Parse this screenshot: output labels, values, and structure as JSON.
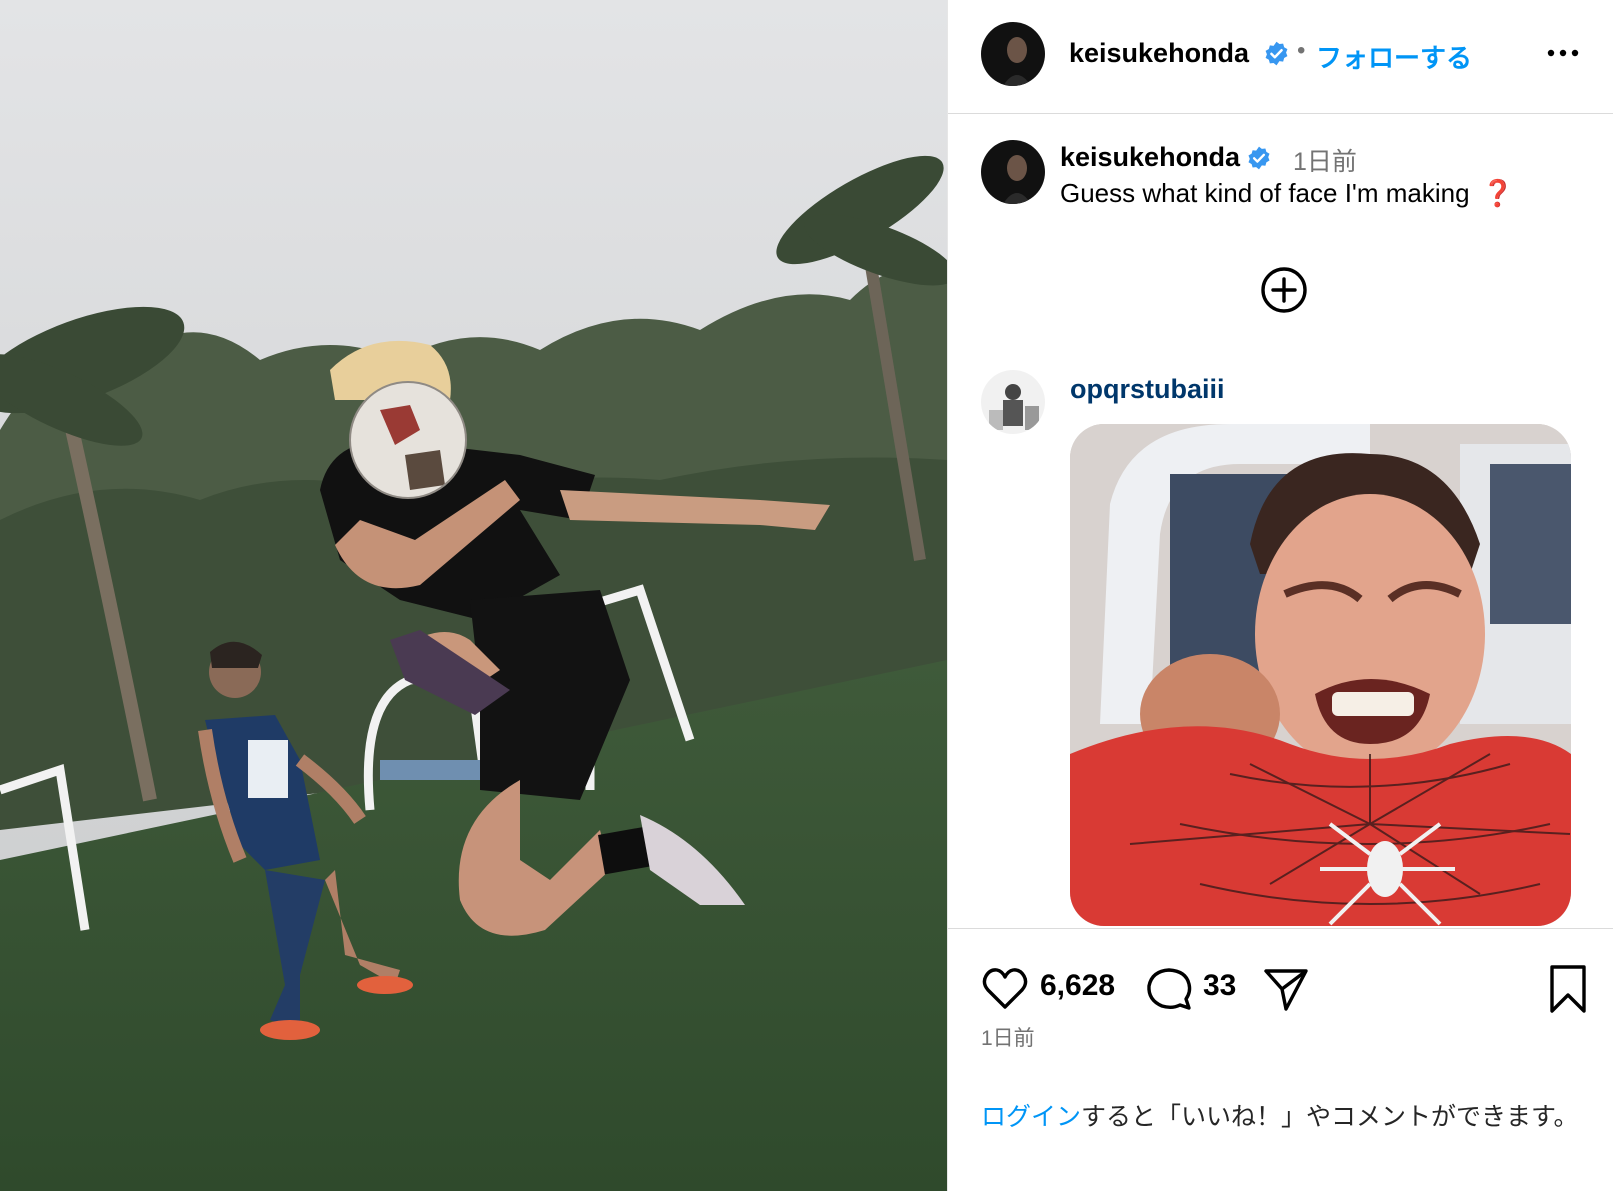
{
  "colors": {
    "accent": "#0095f6",
    "verified": "#3897f0",
    "muted": "#737373",
    "question_mark": "#e0312c",
    "commenter_name": "#00376b"
  },
  "photo": {
    "icon": "photo-soccer-player-headering-ball"
  },
  "header": {
    "username": "keisukehonda",
    "verified_icon": "verified-badge-icon",
    "separator": "•",
    "follow_label": "フォローする",
    "more_icon": "more-options-icon"
  },
  "caption": {
    "username": "keisukehonda",
    "time": "1日前",
    "text": "Guess what kind of face I'm making",
    "emoji": "❓"
  },
  "more_comments": {
    "icon": "plus-circle-icon"
  },
  "comment": {
    "username": "opqrstubaiii",
    "gif_icon": "spider-man-grimace-gif"
  },
  "actions": {
    "like_icon": "heart-icon",
    "like_count": "6,628",
    "comment_icon": "comment-icon",
    "comment_count": "33",
    "share_icon": "share-icon",
    "save_icon": "bookmark-icon",
    "post_time": "1日前"
  },
  "login_note": {
    "link": "ログイン",
    "text": "すると「いいね！」やコメントができます。"
  }
}
